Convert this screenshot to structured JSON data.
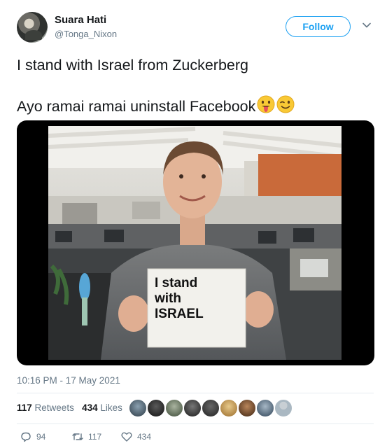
{
  "tweet": {
    "author_name": "Suara Hati",
    "author_handle": "@Tonga_Nixon",
    "follow_label": "Follow",
    "text_line1": "I stand with Israel from Zuckerberg",
    "text_line2": "Ayo ramai ramai uninstall Facebook",
    "emojis": [
      "tongue-out-face-emoji",
      "winking-face-emoji"
    ],
    "image_sign_text": [
      "I stand",
      "with",
      "ISRAEL"
    ],
    "timestamp": "10:16 PM - 17 May 2021"
  },
  "stats": {
    "retweets_count": "117",
    "retweets_label": "Retweets",
    "likes_count": "434",
    "likes_label": "Likes"
  },
  "actions": {
    "reply_count": "94",
    "retweet_count": "117",
    "like_count": "434"
  },
  "colors": {
    "accent": "#1da1f2",
    "secondary_text": "#657786",
    "primary_text": "#14171a",
    "divider": "#e6ecf0"
  }
}
